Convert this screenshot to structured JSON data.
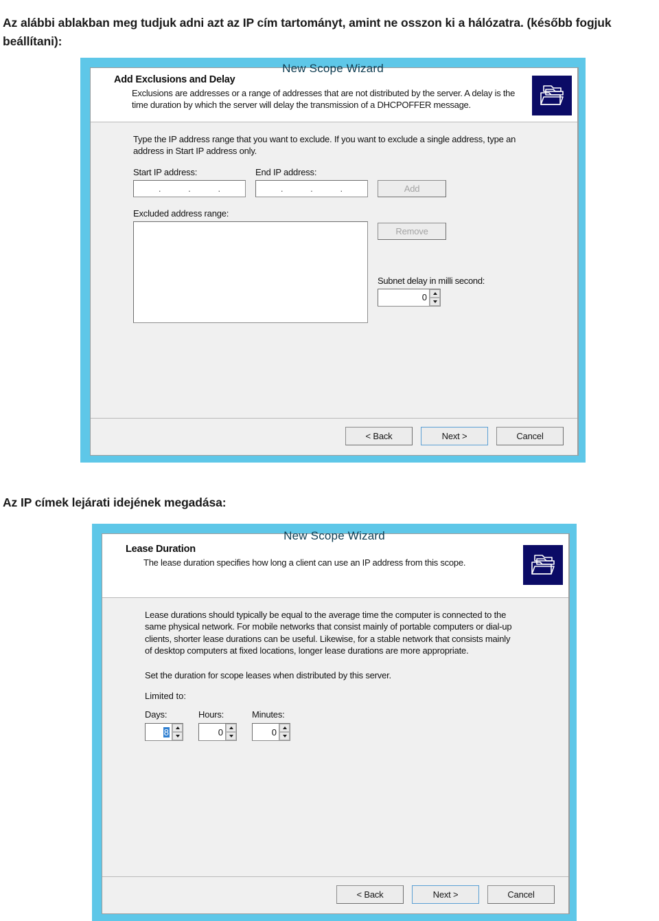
{
  "document": {
    "intro_paragraph": "Az alábbi ablakban meg tudjuk adni azt az IP cím tartományt, amint ne osszon ki a hálózatra. (később fogjuk beállítani):",
    "mid_paragraph": "Az IP címek lejárati idejének megadása:"
  },
  "dialog1": {
    "title": "New Scope Wizard",
    "header_title": "Add Exclusions and Delay",
    "header_description": "Exclusions are addresses or a range of addresses that are not distributed by the server. A delay is the time duration by which the server will delay the transmission of a DHCPOFFER message.",
    "icon": "folder-stack-icon",
    "body_instruction": "Type the IP address range that you want to exclude. If you want to exclude a single address, type an address in Start IP address only.",
    "start_ip_label": "Start IP address:",
    "start_ip_value": "",
    "start_ip_placeholder": ".   .   .",
    "end_ip_label": "End IP address:",
    "end_ip_value": "",
    "end_ip_placeholder": ".   .   .",
    "add_button": "Add",
    "excluded_range_label": "Excluded address range:",
    "excluded_range_items": [],
    "remove_button": "Remove",
    "subnet_delay_label": "Subnet delay in milli second:",
    "subnet_delay_value": "0",
    "footer": {
      "back_button": "< Back",
      "next_button": "Next >",
      "cancel_button": "Cancel"
    }
  },
  "dialog2": {
    "title": "New Scope Wizard",
    "header_title": "Lease Duration",
    "header_description": "The lease duration specifies how long a client can use an IP address from this scope.",
    "icon": "folder-stack-icon",
    "body_paragraph": "Lease durations should typically be equal to the average time the computer is connected to the same physical network. For mobile networks that consist mainly of portable computers or dial-up clients, shorter lease durations can be useful. Likewise, for a stable network that consists mainly of desktop computers at fixed locations, longer lease durations are more appropriate.",
    "set_duration_text": "Set the duration for scope leases when distributed by this server.",
    "limited_to_label": "Limited to:",
    "days_label": "Days:",
    "days_value": "8",
    "hours_label": "Hours:",
    "hours_value": "0",
    "minutes_label": "Minutes:",
    "minutes_value": "0",
    "footer": {
      "back_button": "< Back",
      "next_button": "Next >",
      "cancel_button": "Cancel"
    }
  },
  "colors": {
    "frame_cyan": "#5ec7e8",
    "dialog_face": "#f0f0f0",
    "header_white": "#ffffff",
    "icon_navy": "#0b0b66",
    "selection_blue": "#2f7fd1",
    "focus_border": "#5a9fd4",
    "title_text": "#0f3d52"
  }
}
